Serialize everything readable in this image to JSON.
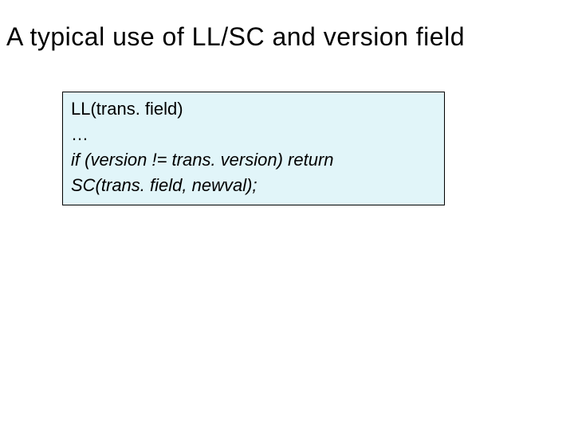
{
  "title": "A typical use of LL/SC and version field",
  "code": {
    "line1": "LL(trans. field)",
    "line2": "…",
    "line3": "if  (version != trans. version) return",
    "line4": "SC(trans. field, newval);"
  }
}
